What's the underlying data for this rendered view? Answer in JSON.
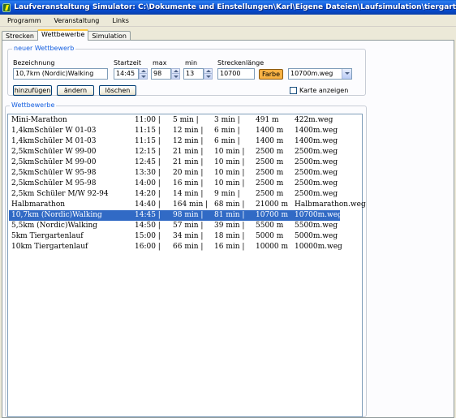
{
  "window": {
    "title": "Laufveranstaltung Simulator: C:\\Dokumente und Einstellungen\\Karl\\Eigene Dateien\\Laufsimulation\\tiergartenlauf.lsi"
  },
  "menu": {
    "items": [
      "Programm",
      "Veranstaltung",
      "Links"
    ]
  },
  "tabs": [
    {
      "label": "Strecken",
      "active": false
    },
    {
      "label": "Wettbewerbe",
      "active": true
    },
    {
      "label": "Simulation",
      "active": false
    }
  ],
  "form": {
    "legend": "neuer Wettbewerb",
    "bezeichnung_label": "Bezeichnung",
    "bezeichnung_value": "10,7km (Nordic)Walking",
    "startzeit_label": "Startzeit",
    "startzeit_value": "14:45",
    "max_label": "max",
    "max_value": "98",
    "min_label": "min",
    "min_value": "13",
    "streckenlaenge_label": "Streckenlänge",
    "streckenlaenge_value": "10700",
    "farbe_label": "Farbe",
    "farbe_color": "#f7b244",
    "route_select_value": "10700m.weg",
    "add_label": "hinzufügen",
    "change_label": "ändern",
    "delete_label": "löschen",
    "karte_label": "Karte anzeigen",
    "karte_checked": false
  },
  "list": {
    "legend": "Wettbewerbe",
    "selected_index": 9,
    "rows": [
      [
        "Mini-Marathon",
        "11:00 |",
        "5 min |",
        "3 min |",
        "491 m",
        "422m.weg"
      ],
      [
        "1,4kmSchüler W 01-03",
        "11:15 |",
        "12 min |",
        "6 min |",
        "1400 m",
        "1400m.weg"
      ],
      [
        "1,4kmSchüler M 01-03",
        "11:15 |",
        "12 min |",
        "6 min |",
        "1400 m",
        "1400m.weg"
      ],
      [
        "2,5kmSchüler W 99-00",
        "12:15 |",
        "21 min |",
        "10 min |",
        "2500 m",
        "2500m.weg"
      ],
      [
        "2,5kmSchüler M 99-00",
        "12:45 |",
        "21 min |",
        "10 min |",
        "2500 m",
        "2500m.weg"
      ],
      [
        "2,5kmSchüler W 95-98",
        "13:30 |",
        "20 min |",
        "10 min |",
        "2500 m",
        "2500m.weg"
      ],
      [
        "2,5kmSchüler M 95-98",
        "14:00 |",
        "16 min |",
        "10 min |",
        "2500 m",
        "2500m.weg"
      ],
      [
        "2,5km Schüler M/W 92-94",
        "14:20 |",
        "14 min |",
        "9 min |",
        "2500 m",
        "2500m.weg"
      ],
      [
        "Halbmarathon",
        "14:40 |",
        "164 min |",
        "68 min |",
        "21000 m",
        "Halbmarathon.weg"
      ],
      [
        "10,7km (Nordic)Walking",
        "14:45 |",
        "98 min |",
        "81 min |",
        "10700 m",
        "10700m.weg"
      ],
      [
        "5,5km (Nordic)Walking",
        "14:50 |",
        "57 min |",
        "39 min |",
        "5500 m",
        "5500m.weg"
      ],
      [
        "5km Tiergartenlauf",
        "15:00 |",
        "34 min |",
        "18 min |",
        "5000 m",
        "5000m.weg"
      ],
      [
        "10km Tiergartenlauf",
        "16:00 |",
        "66 min |",
        "16 min |",
        "10000 m",
        "10000m.weg"
      ]
    ]
  }
}
